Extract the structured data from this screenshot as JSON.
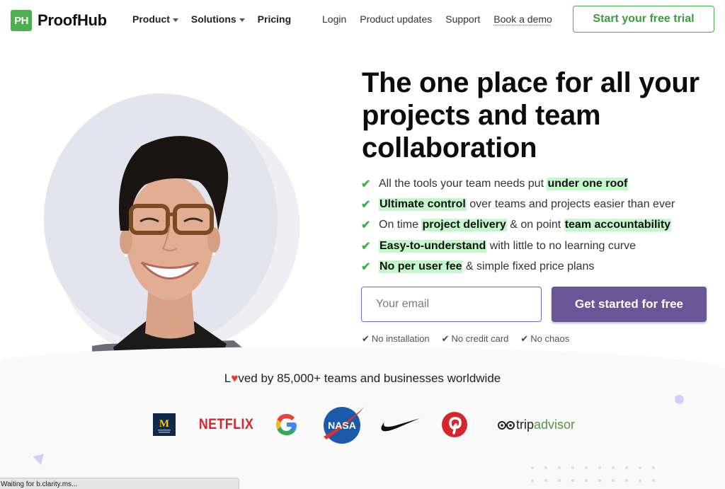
{
  "nav": {
    "logo_mark": "PH",
    "logo_text": "ProofHub",
    "left_items": [
      {
        "label": "Product",
        "has_dropdown": true
      },
      {
        "label": "Solutions",
        "has_dropdown": true
      },
      {
        "label": "Pricing",
        "has_dropdown": false
      }
    ],
    "right_links": [
      "Login",
      "Product updates",
      "Support",
      "Book a demo"
    ],
    "cta_label": "Start your free trial"
  },
  "hero": {
    "headline": "The one place for all your projects and team collaboration",
    "features": [
      [
        {
          "t": "All the tools your team needs put "
        },
        {
          "t": "under one roof",
          "hl": true
        }
      ],
      [
        {
          "t": "Ultimate control",
          "hl": true
        },
        {
          "t": " over teams and projects easier than ever"
        }
      ],
      [
        {
          "t": "On time "
        },
        {
          "t": "project delivery",
          "hl": true
        },
        {
          "t": " & on point "
        },
        {
          "t": "team accountability",
          "hl": true
        }
      ],
      [
        {
          "t": "Easy-to-understand",
          "hl": true
        },
        {
          "t": " with little to no learning curve"
        }
      ],
      [
        {
          "t": "No per user fee",
          "hl": true
        },
        {
          "t": " & simple fixed price plans"
        }
      ]
    ],
    "email_placeholder": "Your email",
    "email_value": "",
    "cta_label": "Get started for free",
    "perks": [
      "No installation",
      "No credit card",
      "No chaos"
    ]
  },
  "social_proof": {
    "loved_prefix": "L",
    "loved_suffix": "ved by 85,000+ teams and businesses worldwide",
    "logos": [
      "michigan-medicine-logo",
      "netflix-logo",
      "google-logo",
      "nasa-logo",
      "nike-logo",
      "pinterest-logo",
      "tripadvisor-logo"
    ],
    "netflix_text": "NETFLIX",
    "nasa_text": "NASA",
    "trip_text_a": "trip",
    "trip_text_b": "advisor",
    "michigan_text": "M"
  },
  "status_bar": {
    "text": "Waiting for b.clarity.ms..."
  },
  "colors": {
    "brand_green": "#4caf50",
    "cta_purple": "#6a5597",
    "highlight": "#c5f7cd",
    "check_green": "#3fae4c"
  }
}
